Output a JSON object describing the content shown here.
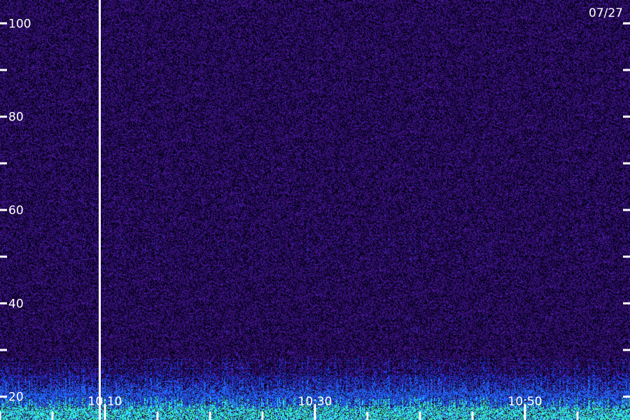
{
  "date": "07/27",
  "colors": {
    "background": "#2a0a5e",
    "noise_dark": "#000010",
    "noise_light": "#4a1aa0",
    "low_band_blue": "#1e6bff",
    "low_band_cyan": "#30e0ff",
    "low_band_green": "#40ff60",
    "axis": "#ffffff",
    "cursor": "#ffffff"
  },
  "chart_data": {
    "type": "heatmap",
    "title": "",
    "xlabel": "",
    "ylabel": "",
    "ylim": [
      15,
      105
    ],
    "xlim": [
      "10:00",
      "11:00"
    ],
    "y_ticks": [
      {
        "value": 100,
        "label": "100"
      },
      {
        "value": 80,
        "label": "80"
      },
      {
        "value": 60,
        "label": "60"
      },
      {
        "value": 40,
        "label": "40"
      },
      {
        "value": 20,
        "label": "20"
      }
    ],
    "y_minor_ticks": [
      90,
      70,
      50,
      30
    ],
    "x_ticks": [
      {
        "value": "10:10",
        "label": "10:10"
      },
      {
        "value": "10:30",
        "label": "10:30"
      },
      {
        "value": "10:50",
        "label": "10:50"
      }
    ],
    "x_minor_ticks": [
      "10:00",
      "10:05",
      "10:15",
      "10:20",
      "10:25",
      "10:35",
      "10:40",
      "10:45",
      "10:55"
    ],
    "cursor_time": "10:09.5",
    "intensity_profile": {
      "description_levels": "relative intensity by y value, 0 = dark noise, 1 = saturated",
      "levels": [
        {
          "y": 15,
          "level": 0.95
        },
        {
          "y": 17,
          "level": 0.8
        },
        {
          "y": 19,
          "level": 0.55
        },
        {
          "y": 21,
          "level": 0.3
        },
        {
          "y": 25,
          "level": 0.12
        },
        {
          "y": 30,
          "level": 0.06
        },
        {
          "y": 105,
          "level": 0.04
        }
      ]
    },
    "grid": false,
    "legend": "none"
  }
}
